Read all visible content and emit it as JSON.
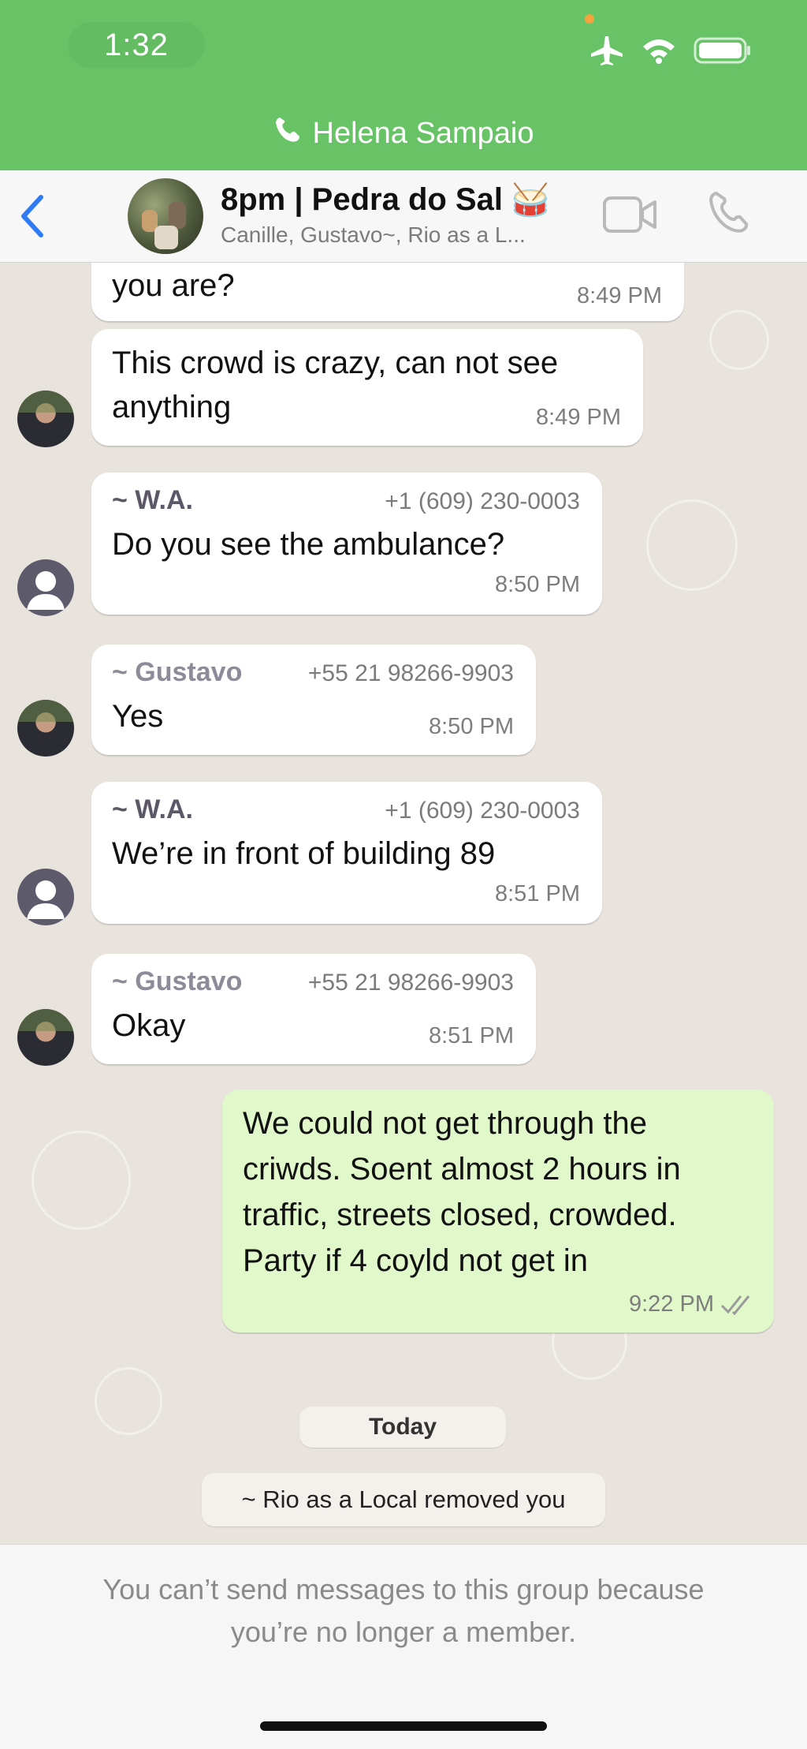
{
  "status_bar": {
    "time": "1:32"
  },
  "call_banner": {
    "name": "Helena Sampaio"
  },
  "header": {
    "title": "8pm | Pedra do Sal",
    "title_emoji": "🥁",
    "subtitle": "Canille, Gustavo~, Rio as a L..."
  },
  "messages": [
    {
      "text": "you are?",
      "time": "8:49 PM"
    },
    {
      "text_line1": "This crowd is crazy, can not see",
      "text_line2": "anything",
      "time": "8:49 PM"
    },
    {
      "sender": "~ W.A.",
      "phone": "+1 (609) 230-0003",
      "text": "Do you see the ambulance?",
      "time": "8:50 PM"
    },
    {
      "sender": "~ Gustavo",
      "phone": "+55 21 98266-9903",
      "text": "Yes",
      "time": "8:50 PM"
    },
    {
      "sender": "~ W.A.",
      "phone": "+1 (609) 230-0003",
      "text": "We’re in front of building 89",
      "time": "8:51 PM"
    },
    {
      "sender": "~ Gustavo",
      "phone": "+55 21 98266-9903",
      "text": "Okay",
      "time": "8:51 PM"
    },
    {
      "lines": [
        "We could not get through the",
        "criwds. Soent almost 2 hours in",
        "traffic, streets closed, crowded.",
        "Party if 4 coyld not get in"
      ],
      "time": "9:22 PM"
    }
  ],
  "day_divider": "Today",
  "system_message": "~ Rio as a Local removed you",
  "footer": {
    "line1": "You can’t send messages to this group because",
    "line2": "you’re no longer a member."
  },
  "colors": {
    "call_banner_green": "#68c366",
    "outgoing_bubble": "#e1f8cb",
    "wa_name_color": "#5b5766",
    "gustavo_name_color": "#8e8a99",
    "ios_blue": "#2f7bf5"
  },
  "icons": [
    "phone-icon",
    "airplane-icon",
    "wifi-icon",
    "battery-icon",
    "back-chevron-icon",
    "video-call-icon",
    "voice-call-icon",
    "read-receipt-icon"
  ]
}
